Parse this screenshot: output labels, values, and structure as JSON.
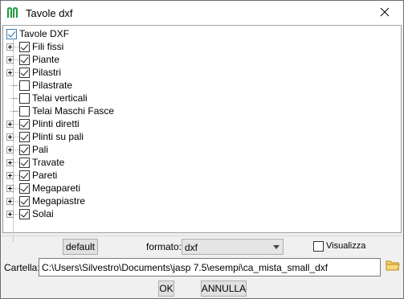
{
  "window": {
    "title": "Tavole dxf",
    "app_icon": "app-logo-icon",
    "close_icon": "close-icon"
  },
  "tree": {
    "root": {
      "label": "Tavole DXF",
      "checked": true
    },
    "items": [
      {
        "label": "Fili fissi",
        "checked": true,
        "expandable": true
      },
      {
        "label": "Piante",
        "checked": true,
        "expandable": true
      },
      {
        "label": "Pilastri",
        "checked": true,
        "expandable": true
      },
      {
        "label": "Pilastrate",
        "checked": false,
        "expandable": false
      },
      {
        "label": "Telai verticali",
        "checked": false,
        "expandable": false
      },
      {
        "label": "Telai Maschi Fasce",
        "checked": false,
        "expandable": false
      },
      {
        "label": "Plinti diretti",
        "checked": true,
        "expandable": true
      },
      {
        "label": "Plinti su pali",
        "checked": true,
        "expandable": true
      },
      {
        "label": "Pali",
        "checked": true,
        "expandable": true
      },
      {
        "label": "Travate",
        "checked": true,
        "expandable": true
      },
      {
        "label": "Pareti",
        "checked": true,
        "expandable": true
      },
      {
        "label": "Megapareti",
        "checked": true,
        "expandable": true
      },
      {
        "label": "Megapiastre",
        "checked": true,
        "expandable": true
      },
      {
        "label": "Solai",
        "checked": true,
        "expandable": true
      }
    ]
  },
  "controls": {
    "default_label": "default",
    "format_label": "formato:",
    "format_value": "dxf",
    "visualizza_label": "Visualizza",
    "visualizza_checked": false,
    "cartella_label": "Cartella:",
    "path_value": "C:\\Users\\Silvestro\\Documents\\jasp 7.5\\esempi\\ca_mista_small_dxf",
    "ok_label": "OK",
    "annulla_label": "ANNULLA"
  },
  "colors": {
    "accent": "#1e9b3c",
    "checkbox_root": "#3c7fb1",
    "folder": "#e8b84a"
  }
}
